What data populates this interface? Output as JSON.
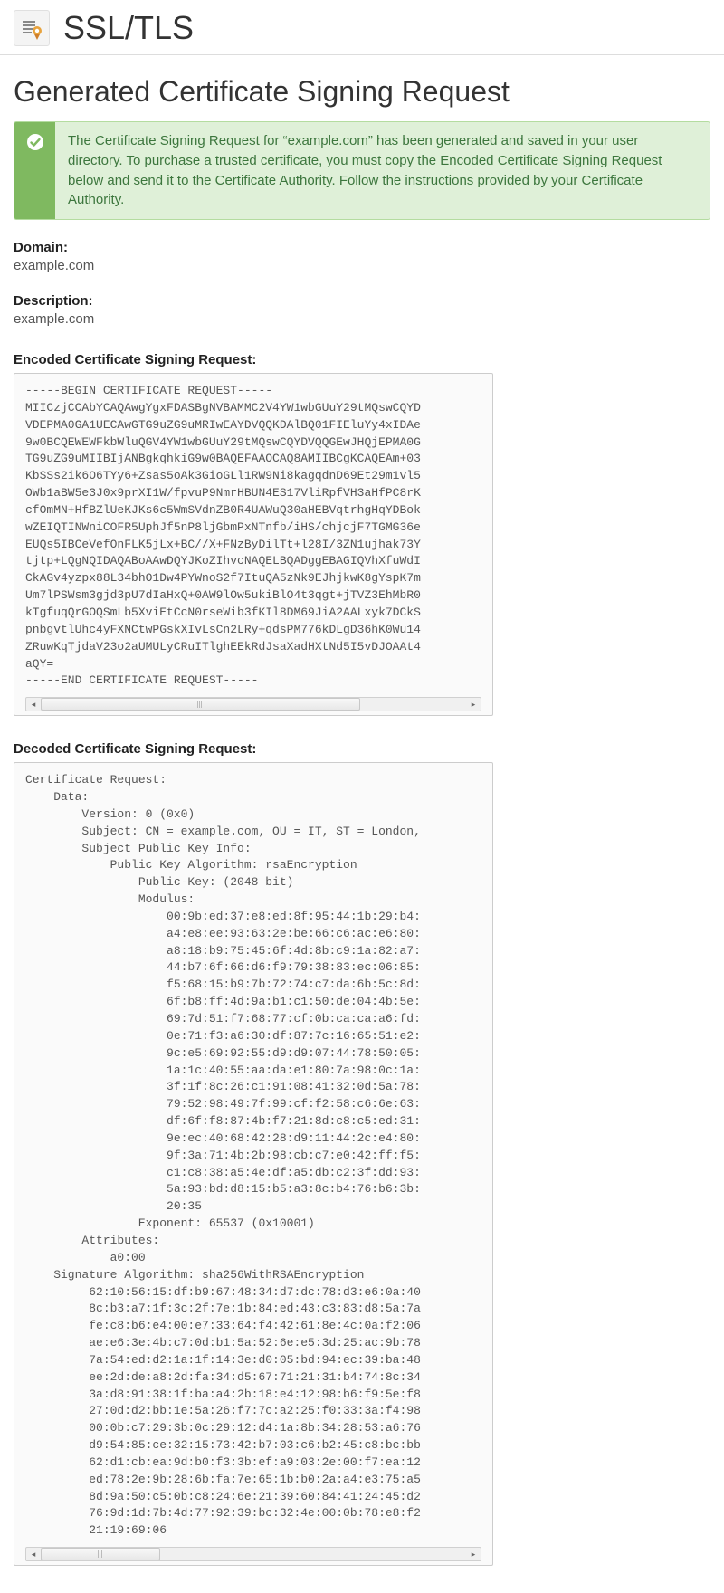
{
  "header": {
    "title": "SSL/TLS"
  },
  "subtitle": "Generated Certificate Signing Request",
  "alert": {
    "text": "The Certificate Signing Request for “example.com” has been generated and saved in your user directory. To purchase a trusted certificate, you must copy the Encoded Certificate Signing Request below and send it to the Certificate Authority. Follow the instructions provided by your Certificate Authority."
  },
  "fields": {
    "domain_label": "Domain:",
    "domain_value": "example.com",
    "description_label": "Description:",
    "description_value": "example.com"
  },
  "encoded": {
    "label": "Encoded Certificate Signing Request:",
    "content": "-----BEGIN CERTIFICATE REQUEST-----\nMIICzjCCAbYCAQAwgYgxFDASBgNVBAMMC2V4YW1wbGUuY29tMQswCQYD\nVDEPMA0GA1UECAwGTG9uZG9uMRIwEAYDVQQKDAlBQ01FIEluYy4xIDAe\n9w0BCQEWEWFkbWluQGV4YW1wbGUuY29tMQswCQYDVQQGEwJHQjEPMA0G\nTG9uZG9uMIIBIjANBgkqhkiG9w0BAQEFAAOCAQ8AMIIBCgKCAQEAm+03\nKbSSs2ik6O6TYy6+Zsas5oAk3GioGLl1RW9Ni8kagqdnD69Et29m1vl5\nOWb1aBW5e3J0x9prXI1W/fpvuP9NmrHBUN4ES17VliRpfVH3aHfPC8rK\ncfOmMN+HfBZlUeKJKs6c5WmSVdnZB0R4UAWuQ30aHEBVqtrhgHqYDBok\nwZEIQTINWniCOFR5UphJf5nP8ljGbmPxNTnfb/iHS/chjcjF7TGMG36e\nEUQs5IBCeVefOnFLK5jLx+BC//X+FNzByDilTt+l28I/3ZN1ujhak73Y\ntjtp+LQgNQIDAQABoAAwDQYJKoZIhvcNAQELBQADggEBAGIQVhXfuWdI\nCkAGv4yzpx88L34bhO1Dw4PYWnoS2f7ItuQA5zNk9EJhjkwK8gYspK7m\nUm7lPSWsm3gjd3pU7dIaHxQ+0AW9lOw5ukiBlO4t3qgt+jTVZ3EhMbR0\nkTgfuqQrGOQSmLb5XviEtCcN0rseWib3fKIl8DM69JiA2AALxyk7DCkS\npnbgvtlUhc4yFXNCtwPGskXIvLsCn2LRy+qdsPM776kDLgD36hK0Wu14\nZRuwKqTjdaV23o2aUMULyCRuITlghEEkRdJsaXadHXtNd5I5vDJOAAt4\naQY=\n-----END CERTIFICATE REQUEST-----"
  },
  "decoded": {
    "label": "Decoded Certificate Signing Request:",
    "content": "Certificate Request:\n    Data:\n        Version: 0 (0x0)\n        Subject: CN = example.com, OU = IT, ST = London,\n        Subject Public Key Info:\n            Public Key Algorithm: rsaEncryption\n                Public-Key: (2048 bit)\n                Modulus:\n                    00:9b:ed:37:e8:ed:8f:95:44:1b:29:b4:\n                    a4:e8:ee:93:63:2e:be:66:c6:ac:e6:80:\n                    a8:18:b9:75:45:6f:4d:8b:c9:1a:82:a7:\n                    44:b7:6f:66:d6:f9:79:38:83:ec:06:85:\n                    f5:68:15:b9:7b:72:74:c7:da:6b:5c:8d:\n                    6f:b8:ff:4d:9a:b1:c1:50:de:04:4b:5e:\n                    69:7d:51:f7:68:77:cf:0b:ca:ca:a6:fd:\n                    0e:71:f3:a6:30:df:87:7c:16:65:51:e2:\n                    9c:e5:69:92:55:d9:d9:07:44:78:50:05:\n                    1a:1c:40:55:aa:da:e1:80:7a:98:0c:1a:\n                    3f:1f:8c:26:c1:91:08:41:32:0d:5a:78:\n                    79:52:98:49:7f:99:cf:f2:58:c6:6e:63:\n                    df:6f:f8:87:4b:f7:21:8d:c8:c5:ed:31:\n                    9e:ec:40:68:42:28:d9:11:44:2c:e4:80:\n                    9f:3a:71:4b:2b:98:cb:c7:e0:42:ff:f5:\n                    c1:c8:38:a5:4e:df:a5:db:c2:3f:dd:93:\n                    5a:93:bd:d8:15:b5:a3:8c:b4:76:b6:3b:\n                    20:35\n                Exponent: 65537 (0x10001)\n        Attributes:\n            a0:00\n    Signature Algorithm: sha256WithRSAEncryption\n         62:10:56:15:df:b9:67:48:34:d7:dc:78:d3:e6:0a:40\n         8c:b3:a7:1f:3c:2f:7e:1b:84:ed:43:c3:83:d8:5a:7a\n         fe:c8:b6:e4:00:e7:33:64:f4:42:61:8e:4c:0a:f2:06\n         ae:e6:3e:4b:c7:0d:b1:5a:52:6e:e5:3d:25:ac:9b:78\n         7a:54:ed:d2:1a:1f:14:3e:d0:05:bd:94:ec:39:ba:48\n         ee:2d:de:a8:2d:fa:34:d5:67:71:21:31:b4:74:8c:34\n         3a:d8:91:38:1f:ba:a4:2b:18:e4:12:98:b6:f9:5e:f8\n         27:0d:d2:bb:1e:5a:26:f7:7c:a2:25:f0:33:3a:f4:98\n         00:0b:c7:29:3b:0c:29:12:d4:1a:8b:34:28:53:a6:76\n         d9:54:85:ce:32:15:73:42:b7:03:c6:b2:45:c8:bc:bb\n         62:d1:cb:ea:9d:b0:f3:3b:ef:a9:03:2e:00:f7:ea:12\n         ed:78:2e:9b:28:6b:fa:7e:65:1b:b0:2a:a4:e3:75:a5\n         8d:9a:50:c5:0b:c8:24:6e:21:39:60:84:41:24:45:d2\n         76:9d:1d:7b:4d:77:92:39:bc:32:4e:00:0b:78:e8:f2\n         21:19:69:06"
  }
}
